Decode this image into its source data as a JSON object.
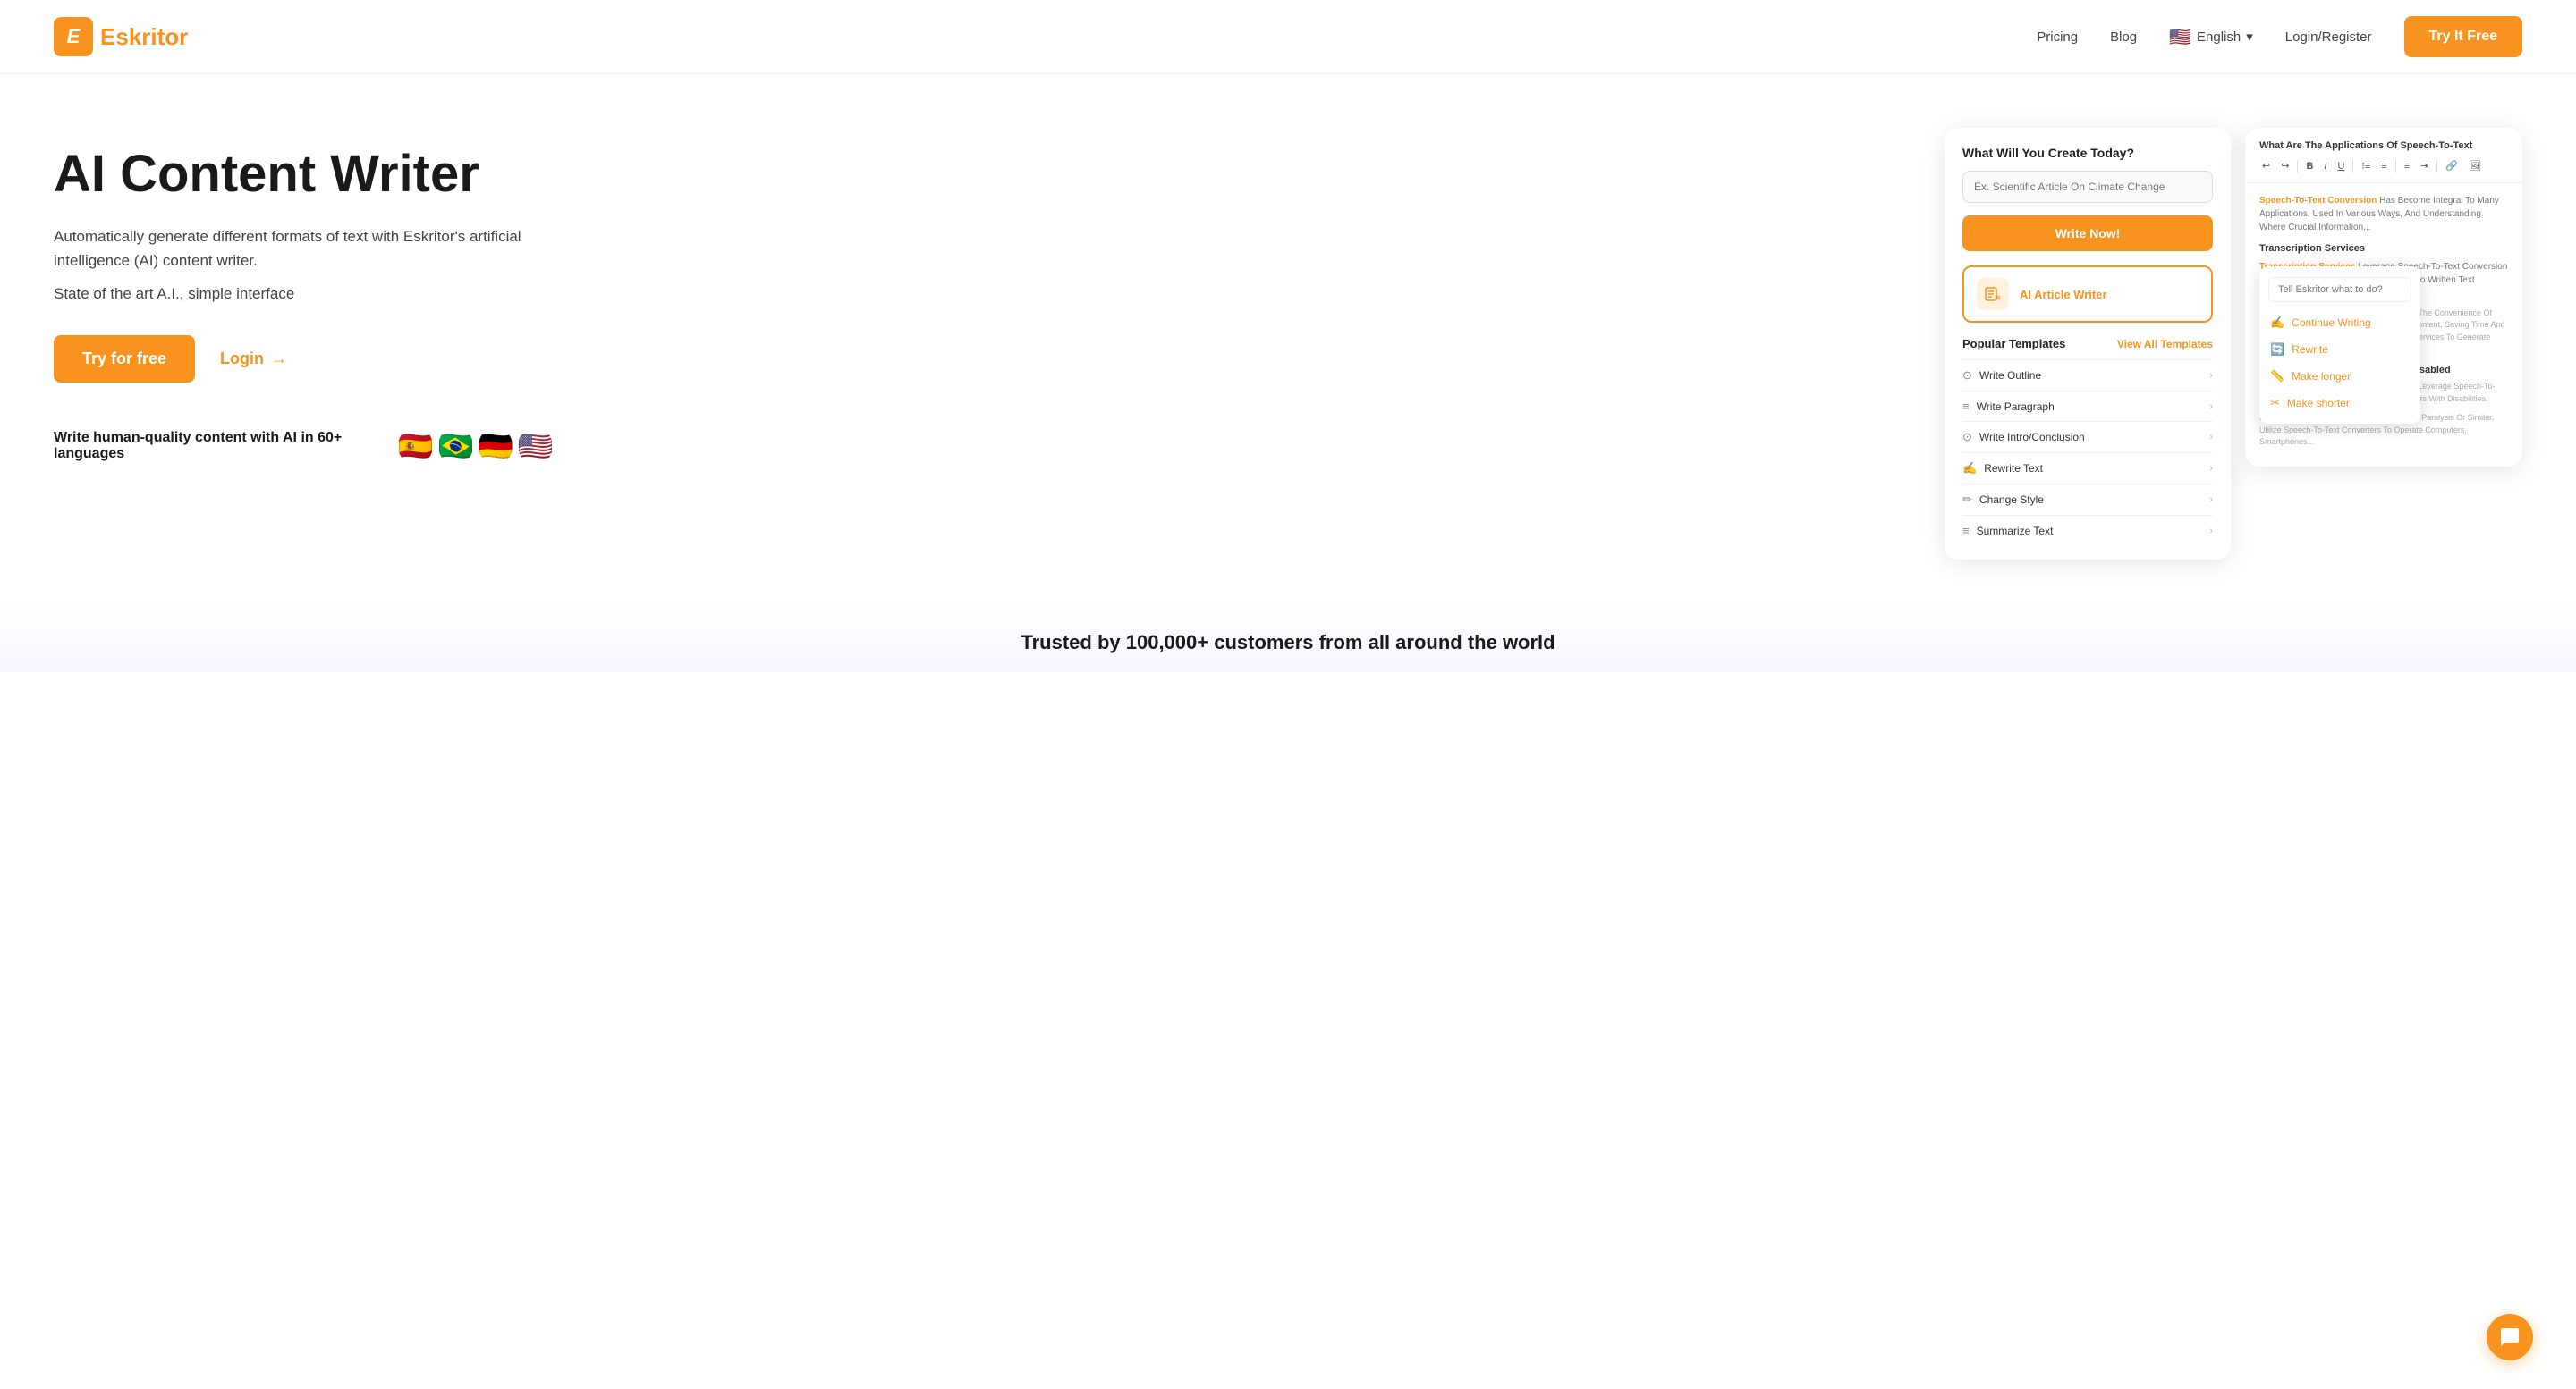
{
  "nav": {
    "logo_letter": "E",
    "logo_name_before": "",
    "logo_name": "skritor",
    "links": [
      {
        "label": "Pricing",
        "id": "pricing"
      },
      {
        "label": "Blog",
        "id": "blog"
      }
    ],
    "lang_flag": "🇺🇸",
    "lang_label": "English",
    "login_label": "Login/Register",
    "try_btn": "Try It Free"
  },
  "hero": {
    "title": "AI Content Writer",
    "desc": "Automatically generate different formats of text with Eskritor's artificial intelligence (AI) content writer.",
    "sub": "State of the art A.I., simple interface",
    "try_btn": "Try for free",
    "login_btn": "Login",
    "arrow": "→",
    "langs_text": "Write human-quality content with AI in 60+ languages",
    "flags": [
      "🇪🇸",
      "🇧🇷",
      "🇩🇪",
      "🇺🇸"
    ]
  },
  "card1": {
    "title": "What Will You Create Today?",
    "input_placeholder": "Ex. Scientific Article On Climate Change",
    "write_btn": "Write Now!",
    "ai_article_label": "AI Article Writer",
    "templates_title": "Popular Templates",
    "view_all": "View All Templates",
    "templates": [
      {
        "icon": "⊙",
        "label": "Write Outline"
      },
      {
        "icon": "≡",
        "label": "Write Paragraph"
      },
      {
        "icon": "⊙",
        "label": "Write Intro/Conclusion"
      },
      {
        "icon": "✍",
        "label": "Rewrite Text"
      },
      {
        "icon": "✏",
        "label": "Change Style"
      },
      {
        "icon": "≡",
        "label": "Summarize Text"
      }
    ]
  },
  "card2": {
    "title": "What Are The Applications Of Speech-To-Text",
    "toolbar": [
      "↩",
      "↪",
      "B",
      "I",
      "U",
      "list1",
      "list2",
      "align",
      "indent",
      "outdent",
      "link",
      "image"
    ],
    "body_text": "Speech-To-Text Conversion Has Become Integral To Many Applications, Used In Various Ways, And Understanding Where Crucial Information...",
    "section1_title": "Transcription Services",
    "section1_text": "Transcription Services Leverage Speech-To-Text Conversion Techniques To Convert Spoken Audio Into Written Text Efficiently. Editors Benefit And...",
    "section1_text2": "...Interviews, Meetings, Lectures, And More. The Convenience Of Quickly And Accurately Transcribing Audio Content, Saving Time And Effort, Professionals Rely On Transcription Services To Generate Written Transcripts Of Research Findings...",
    "section2_title": "Assistive Technologies For The Disabled",
    "section2_text": "Assistive Technologies For The Disabled Leverage Speech-To-Text Accessibility And Independence For Users With Disabilities.",
    "section3_text": "Individuals With Motor Impairments, Such As Paralysis Or Similar, Utilize Speech-To-Text Converters To Operate Computers, Smartphones..."
  },
  "float_menu": {
    "input_placeholder": "Tell Eskritor what to do?",
    "items": [
      {
        "icon": "✍",
        "label": "Continue Writing"
      },
      {
        "icon": "🔄",
        "label": "Rewrite"
      },
      {
        "icon": "📏",
        "label": "Make longer"
      },
      {
        "icon": "✂",
        "label": "Make shorter"
      }
    ]
  },
  "trusted": {
    "text": "Trusted by 100,000+ customers from all around the world"
  },
  "chat": {
    "icon": "💬"
  }
}
